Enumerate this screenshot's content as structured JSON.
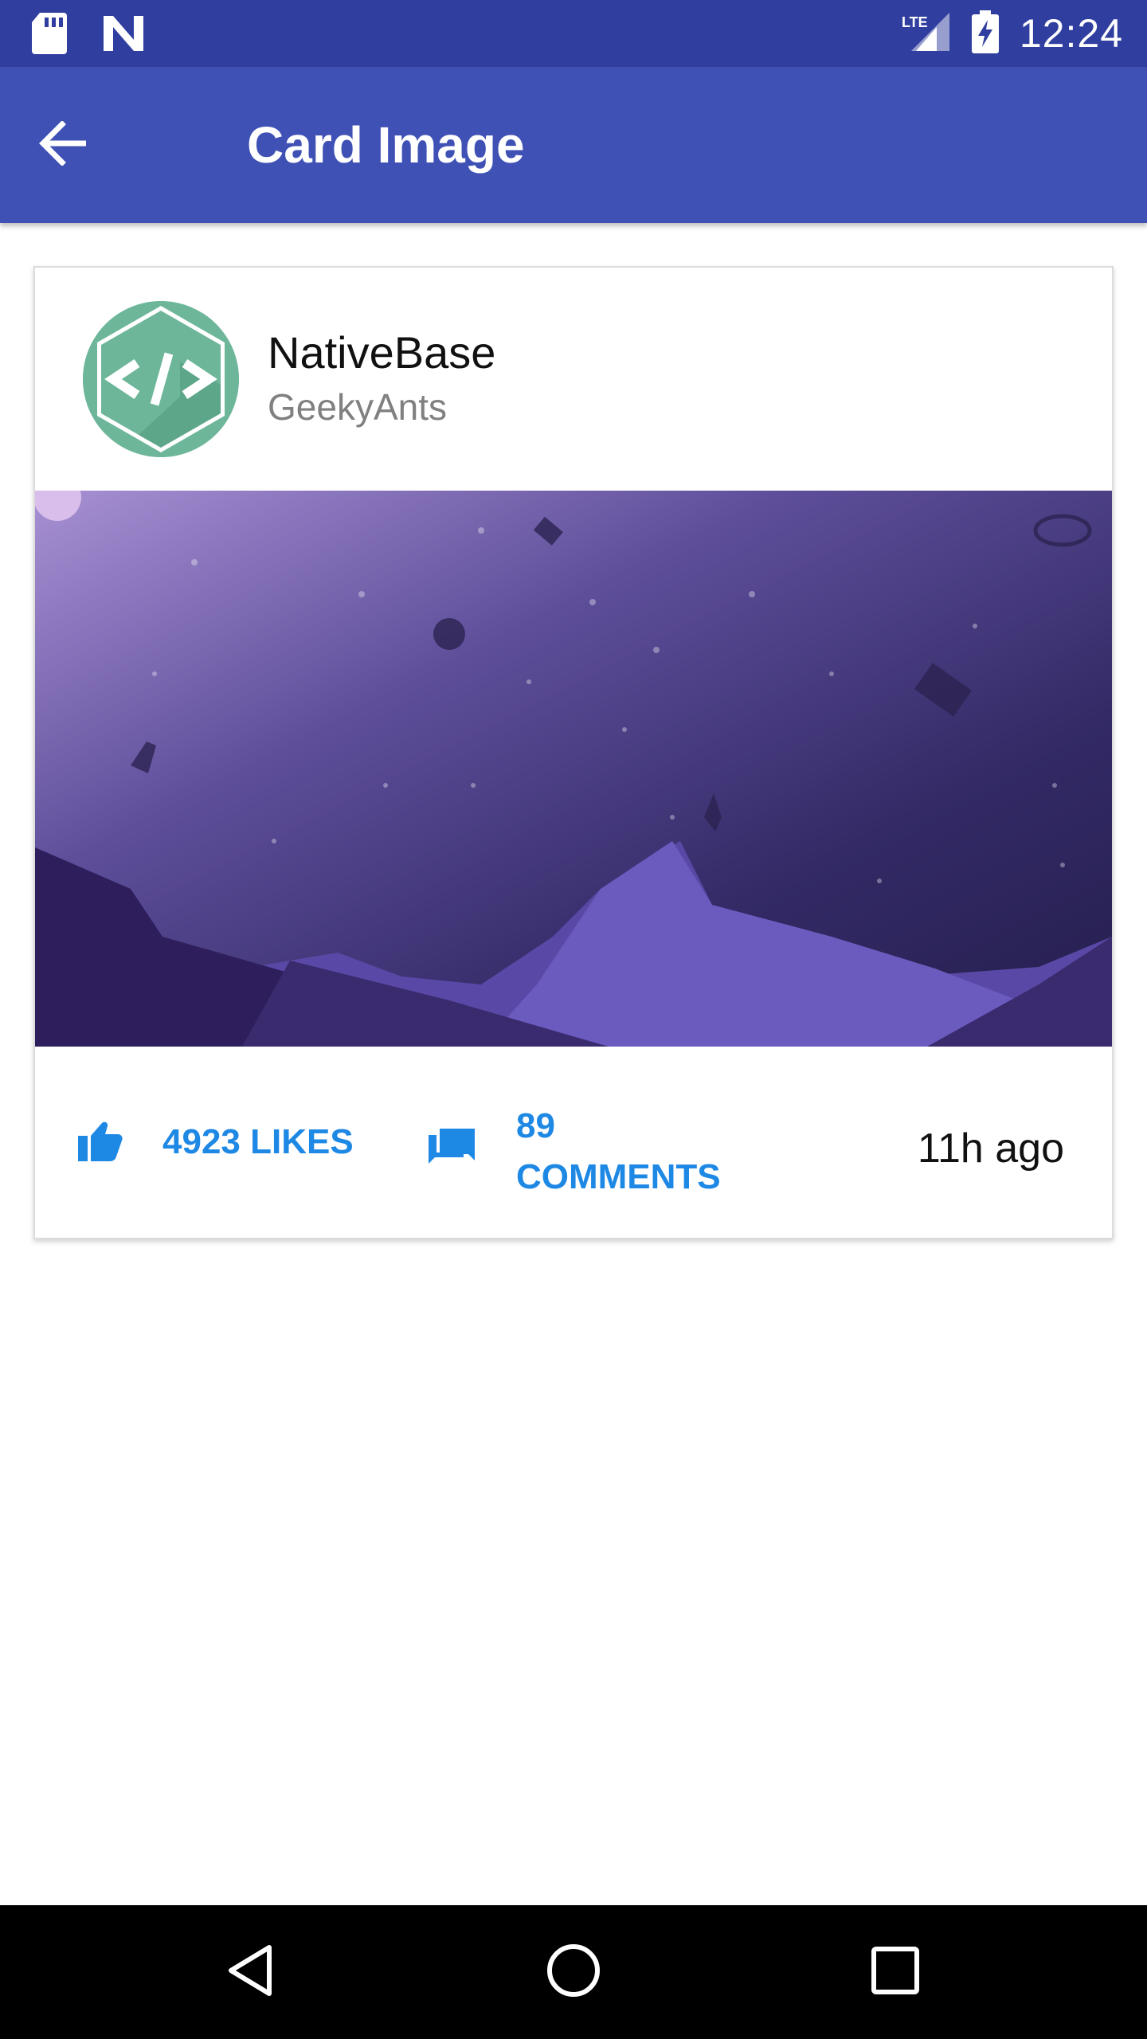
{
  "status_bar": {
    "time": "12:24",
    "network": "LTE",
    "left_icons": [
      "sd-card-icon",
      "n-logo-icon"
    ],
    "right_icons": [
      "signal-icon",
      "battery-icon"
    ]
  },
  "app_bar": {
    "title": "Card Image",
    "back_icon": "arrow-left-icon",
    "background": "#3F51B5"
  },
  "card": {
    "header": {
      "name": "NativeBase",
      "subtitle": "GeekyAnts",
      "avatar_icon": "code-hexagon-icon"
    },
    "image_icon": "space-landscape-image",
    "footer": {
      "likes_label": "4923 LIKES",
      "likes_icon": "thumbs-up-icon",
      "comments_label_line1": "89",
      "comments_label_line2": "COMMENTS",
      "comments_icon": "chat-bubbles-icon",
      "time": "11h ago"
    },
    "accent": "#1E88E5"
  },
  "nav_bar": {
    "buttons": [
      "back-triangle-icon",
      "home-circle-icon",
      "recents-square-icon"
    ]
  }
}
